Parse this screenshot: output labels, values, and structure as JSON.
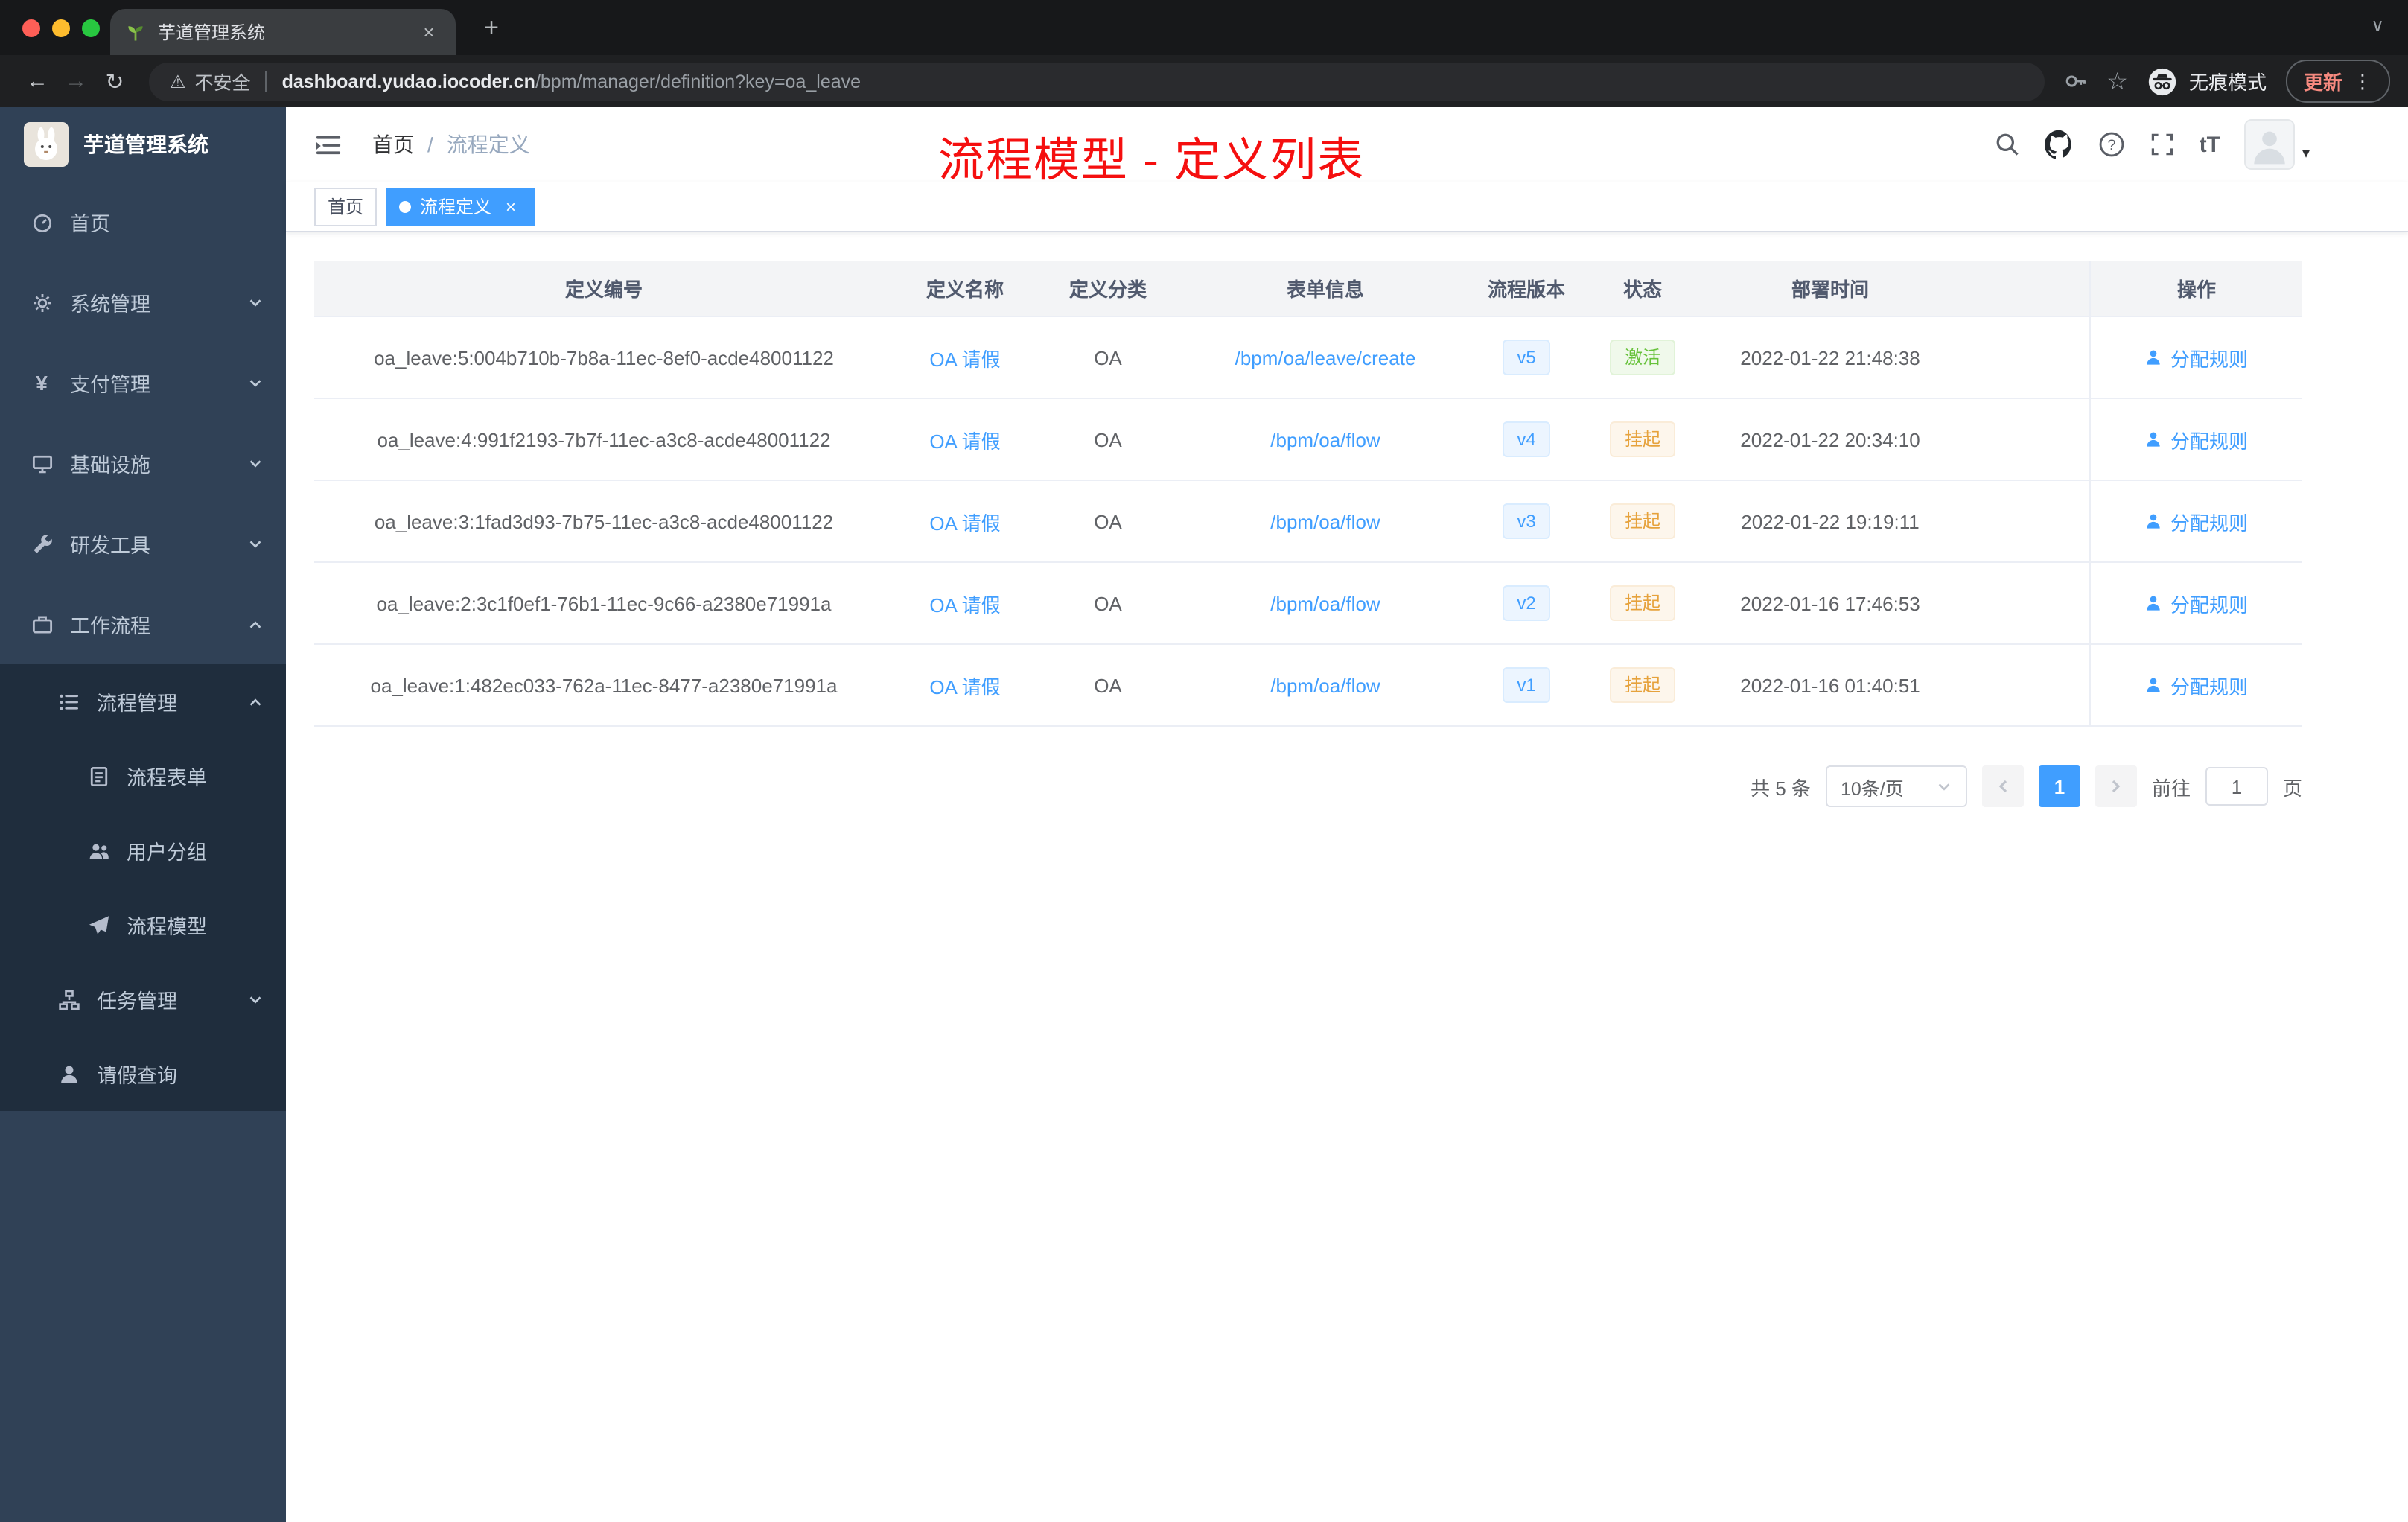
{
  "browser": {
    "tab_title": "芋道管理系统",
    "security_label": "不安全",
    "url_host": "dashboard.yudao.iocoder.cn",
    "url_path": "/bpm/manager/definition?key=oa_leave",
    "incognito_label": "无痕模式",
    "update_label": "更新"
  },
  "icons": {
    "close": "×",
    "plus": "+",
    "window_chevron": "∨",
    "back": "←",
    "forward": "→",
    "reload": "↻",
    "warning": "⚠",
    "star": "☆",
    "kebab": "⋮",
    "caret_down": "▾",
    "yen": "¥",
    "font_size": "tT"
  },
  "sidebar": {
    "logo_title": "芋道管理系统",
    "items": [
      {
        "label": "首页"
      },
      {
        "label": "系统管理"
      },
      {
        "label": "支付管理"
      },
      {
        "label": "基础设施"
      },
      {
        "label": "研发工具"
      },
      {
        "label": "工作流程"
      },
      {
        "label": "流程管理"
      },
      {
        "label": "流程表单"
      },
      {
        "label": "用户分组"
      },
      {
        "label": "流程模型"
      },
      {
        "label": "任务管理"
      },
      {
        "label": "请假查询"
      }
    ]
  },
  "header": {
    "breadcrumb": {
      "home": "首页",
      "separator": "/",
      "current": "流程定义"
    },
    "annotation": "流程模型 - 定义列表"
  },
  "tags": {
    "home": "首页",
    "active": "流程定义"
  },
  "table": {
    "columns": {
      "id": "定义编号",
      "name": "定义名称",
      "category": "定义分类",
      "form": "表单信息",
      "version": "流程版本",
      "status": "状态",
      "deploy_time": "部署时间",
      "actions": "操作"
    },
    "rows": [
      {
        "id": "oa_leave:5:004b710b-7b8a-11ec-8ef0-acde48001122",
        "name": "OA 请假",
        "category": "OA",
        "form": "/bpm/oa/leave/create",
        "version": "v5",
        "status": "激活",
        "status_type": "success",
        "deploy_time": "2022-01-22 21:48:38",
        "action": "分配规则"
      },
      {
        "id": "oa_leave:4:991f2193-7b7f-11ec-a3c8-acde48001122",
        "name": "OA 请假",
        "category": "OA",
        "form": "/bpm/oa/flow",
        "version": "v4",
        "status": "挂起",
        "status_type": "warning",
        "deploy_time": "2022-01-22 20:34:10",
        "action": "分配规则"
      },
      {
        "id": "oa_leave:3:1fad3d93-7b75-11ec-a3c8-acde48001122",
        "name": "OA 请假",
        "category": "OA",
        "form": "/bpm/oa/flow",
        "version": "v3",
        "status": "挂起",
        "status_type": "warning",
        "deploy_time": "2022-01-22 19:19:11",
        "action": "分配规则"
      },
      {
        "id": "oa_leave:2:3c1f0ef1-76b1-11ec-9c66-a2380e71991a",
        "name": "OA 请假",
        "category": "OA",
        "form": "/bpm/oa/flow",
        "version": "v2",
        "status": "挂起",
        "status_type": "warning",
        "deploy_time": "2022-01-16 17:46:53",
        "action": "分配规则"
      },
      {
        "id": "oa_leave:1:482ec033-762a-11ec-8477-a2380e71991a",
        "name": "OA 请假",
        "category": "OA",
        "form": "/bpm/oa/flow",
        "version": "v1",
        "status": "挂起",
        "status_type": "warning",
        "deploy_time": "2022-01-16 01:40:51",
        "action": "分配规则"
      }
    ]
  },
  "pagination": {
    "total": "共 5 条",
    "page_size": "10条/页",
    "current_page": "1",
    "goto_label": "前往",
    "goto_value": "1",
    "page_unit": "页"
  },
  "colors": {
    "accent": "#409eff",
    "annotation_red": "#f50f0f",
    "sidebar_bg": "#304156",
    "submenu_bg": "#1f2d3d",
    "success": "#67c23a",
    "warning": "#e6a23c"
  }
}
